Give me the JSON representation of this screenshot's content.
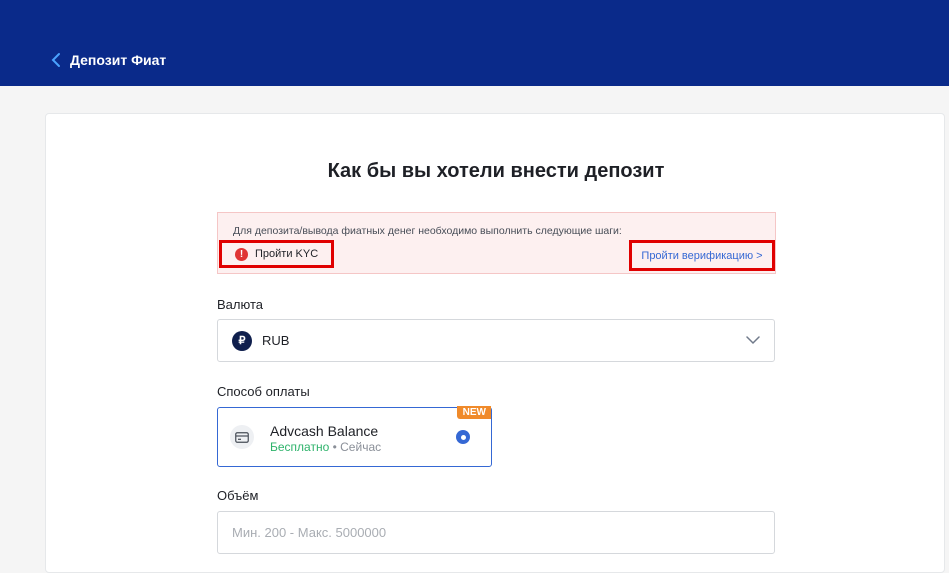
{
  "header": {
    "title": "Депозит Фиат",
    "color": "#0a2a8a"
  },
  "main": {
    "heading": "Как бы вы хотели внести депозит",
    "notice": {
      "text": "Для депозита/вывода фиатных денег необходимо выполнить следующие шаги:",
      "kyc_label": "Пройти KYC",
      "kyc_icon": "!",
      "verify_link": "Пройти верификацию >"
    },
    "currency": {
      "label": "Валюта",
      "symbol": "₽",
      "value": "RUB"
    },
    "payment": {
      "label": "Способ оплаты",
      "badge": "NEW",
      "method": "Advcash Balance",
      "fee": "Бесплатно",
      "timing": "• Сейчас"
    },
    "amount": {
      "label": "Объём",
      "placeholder": "Мин. 200 - Макс. 5000000"
    }
  }
}
